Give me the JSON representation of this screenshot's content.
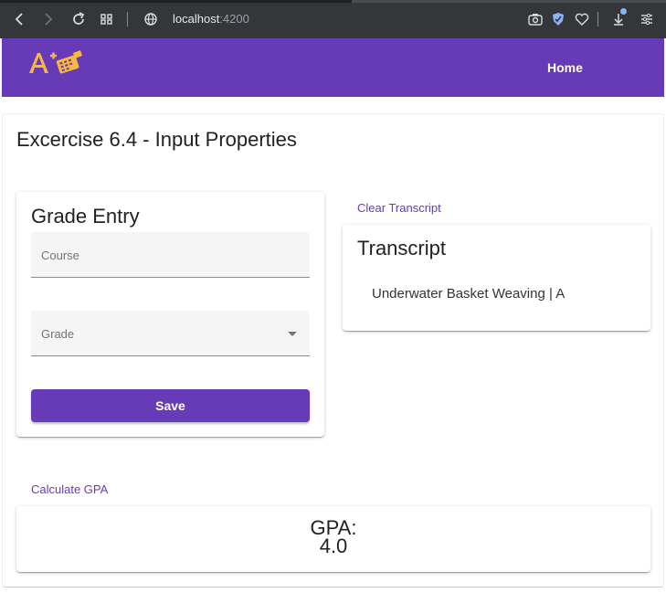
{
  "browser": {
    "url_host": "localhost",
    "url_port": ":4200"
  },
  "toolbar": {
    "home_label": "Home"
  },
  "page": {
    "title": "Excercise 6.4 - Input Properties"
  },
  "grade_entry": {
    "title": "Grade Entry",
    "course_label": "Course",
    "grade_label": "Grade",
    "save_label": "Save"
  },
  "transcript": {
    "clear_label": "Clear Transcript",
    "title": "Transcript",
    "items": [
      "Underwater Basket Weaving | A"
    ]
  },
  "gpa": {
    "calculate_label": "Calculate GPA",
    "label": "GPA:",
    "value": "4.0"
  },
  "colors": {
    "primary": "#673ab7",
    "browser_bar": "#35363a"
  }
}
